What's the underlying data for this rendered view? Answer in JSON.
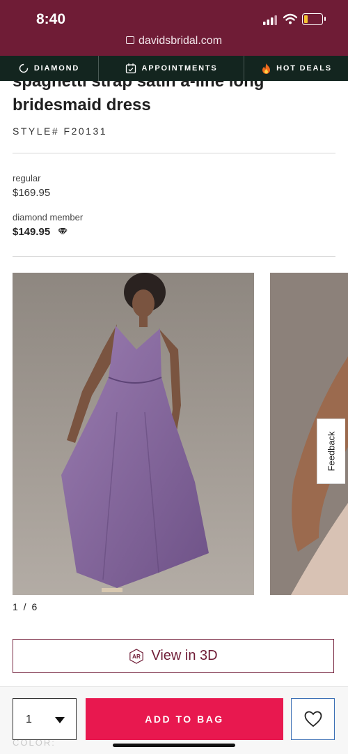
{
  "status_bar": {
    "time": "8:40",
    "url": "davidsbridal.com",
    "battery_level": 0.2,
    "battery_color": "#f4c430"
  },
  "nav": {
    "items": [
      {
        "label": "DIAMOND",
        "icon": "diamond-ring-icon"
      },
      {
        "label": "APPOINTMENTS",
        "icon": "calendar-check-icon"
      },
      {
        "label": "HOT DEALS",
        "icon": "fire-icon"
      }
    ]
  },
  "product": {
    "title": "spaghetti strap satin a-line long bridesmaid dress",
    "style": "STYLE# F20131",
    "regular_label": "regular",
    "regular_price": "$169.95",
    "member_label": "diamond member",
    "member_price": "$149.95"
  },
  "gallery": {
    "counter": "1 / 6",
    "dress_color": "#8a6a9f"
  },
  "feedback_label": "Feedback",
  "view3d": {
    "icon_text": "AR",
    "label": "View in 3D"
  },
  "cart": {
    "quantity": "1",
    "add_label": "ADD TO BAG",
    "faint_label": "COLOR:"
  },
  "colors": {
    "brand": "#6f1c36",
    "nav_bg": "#13251f",
    "add_button": "#e8184f"
  }
}
